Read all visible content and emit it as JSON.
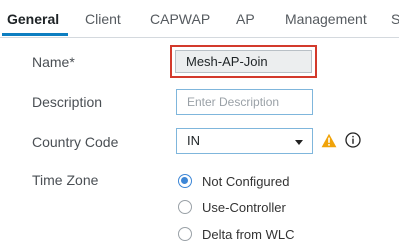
{
  "tabs": [
    {
      "label": "General",
      "active": true
    },
    {
      "label": "Client"
    },
    {
      "label": "CAPWAP"
    },
    {
      "label": "AP"
    },
    {
      "label": "Management"
    },
    {
      "label": "S"
    }
  ],
  "form": {
    "name": {
      "label": "Name*",
      "value": "Mesh-AP-Join"
    },
    "description": {
      "label": "Description",
      "placeholder": "Enter Description",
      "value": ""
    },
    "country_code": {
      "label": "Country Code",
      "selected": "IN"
    },
    "time_zone": {
      "label": "Time Zone",
      "options": [
        {
          "label": "Not Configured",
          "checked": true
        },
        {
          "label": "Use-Controller",
          "checked": false
        },
        {
          "label": "Delta from WLC",
          "checked": false
        }
      ]
    }
  },
  "icons": {
    "warning": "warning-triangle-icon",
    "info": "info-circle-icon"
  },
  "colors": {
    "accent": "#0d7ec1",
    "highlight_border": "#d33a2c",
    "warning": "#f0a30a",
    "radio_selected": "#3d86d6"
  }
}
